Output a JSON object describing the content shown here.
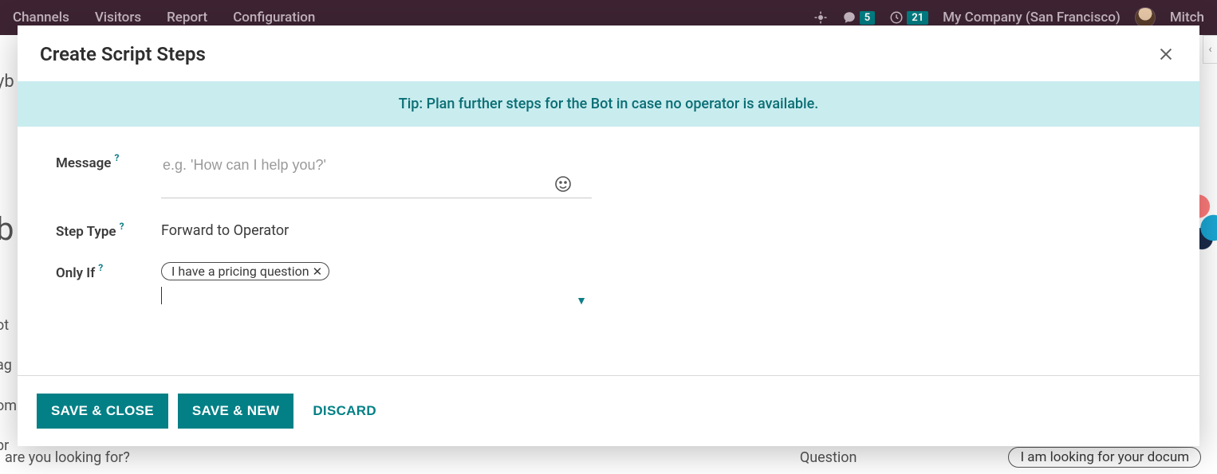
{
  "header": {
    "nav": [
      "Channels",
      "Visitors",
      "Report",
      "Configuration"
    ],
    "messages_badge": "5",
    "activities_badge": "21",
    "company": "My Company (San Francisco)",
    "user_short": "Mitch"
  },
  "background": {
    "crumb_fragment": "yb",
    "big_letter": "b",
    "left_frag_1": "ot",
    "left_frag_2": "ag",
    "left_frag_3": "om",
    "left_frag_4": "br",
    "bottom_question": "are you looking for?",
    "bottom_type": "Question",
    "bottom_tag": "I am looking for your docum"
  },
  "modal": {
    "title": "Create Script Steps",
    "tip": "Tip: Plan further steps for the Bot in case no operator is available.",
    "fields": {
      "message_label": "Message",
      "message_placeholder": "e.g. 'How can I help you?'",
      "message_value": "",
      "step_type_label": "Step Type",
      "step_type_value": "Forward to Operator",
      "only_if_label": "Only If",
      "only_if_tags": [
        "I have a pricing question"
      ]
    },
    "buttons": {
      "save_close": "SAVE & CLOSE",
      "save_new": "SAVE & NEW",
      "discard": "DISCARD"
    }
  }
}
